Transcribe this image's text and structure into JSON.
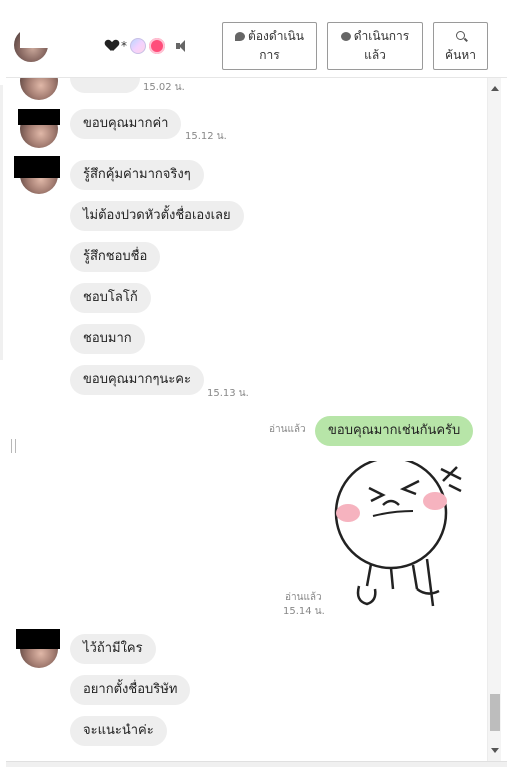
{
  "header": {
    "contact_name_star": "*",
    "buttons": {
      "todo_label": "ต้องดำเนินการ",
      "done_label": "ดำเนินการแล้ว",
      "search_label": "ค้นหา"
    }
  },
  "messages": {
    "top_time": "15.02 น.",
    "m1": {
      "text": "ขอบคุณมากค่า",
      "time": "15.12 น."
    },
    "group2": [
      {
        "text": "รู้สึกคุ้มค่ามากจริงๆ"
      },
      {
        "text": "ไม่ต้องปวดหัวตั้งชื่อเองเลย"
      },
      {
        "text": "รู้สึกชอบชื่อ"
      },
      {
        "text": "ชอบโลโก้"
      },
      {
        "text": "ชอบมาก"
      },
      {
        "text": "ขอบคุณมากๆนะคะ"
      }
    ],
    "group2_time": "15.13 น.",
    "out1": {
      "text": "ขอบคุณมากเช่นกันครับ",
      "read": "อ่านแล้ว"
    },
    "sticker_read": "อ่านแล้ว",
    "sticker_time": "15.14 น.",
    "group3": [
      {
        "text": "ไว้ถ้ามีใคร"
      },
      {
        "text": "อยากตั้งชื่อบริษัท"
      },
      {
        "text": "จะแนะนำค่ะ"
      }
    ]
  },
  "colors": {
    "incoming_bubble": "#eeeeee",
    "outgoing_bubble": "#b7e5a8"
  }
}
